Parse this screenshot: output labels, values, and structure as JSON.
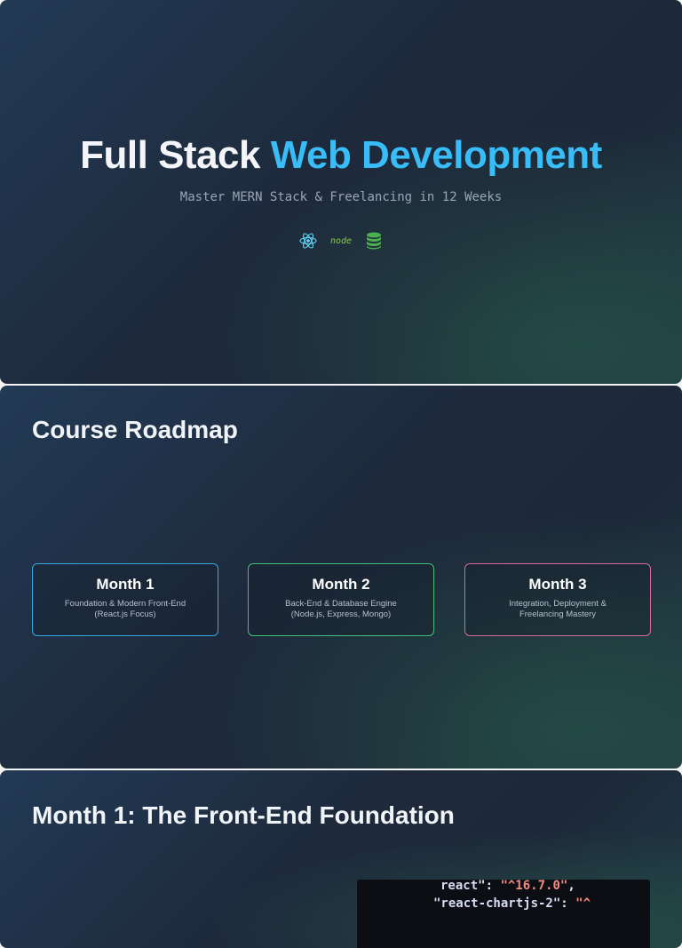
{
  "hero": {
    "title_part1": "Full Stack",
    "title_part2": "Web Development",
    "subtitle": "Master MERN Stack & Freelancing in 12 Weeks",
    "icons": [
      "react-icon",
      "node-icon",
      "database-icon"
    ],
    "node_word": "node"
  },
  "roadmap": {
    "title": "Course Roadmap",
    "cards": [
      {
        "title": "Month 1",
        "line1": "Foundation & Modern Front-End",
        "line2": "(React.js Focus)",
        "border": "#38a8e0"
      },
      {
        "title": "Month 2",
        "line1": "Back-End & Database Engine",
        "line2": "(Node.js, Express, Mongo)",
        "border": "#3fbf7a"
      },
      {
        "title": "Month 3",
        "line1": "Integration, Deployment &",
        "line2": "Freelancing Mastery",
        "border": "#d9679e"
      }
    ]
  },
  "month1": {
    "title": "Month 1: The Front-End Foundation",
    "code": {
      "line1_key": "react",
      "line1_val": "\"^16.7.0\"",
      "line2_key": "\"react-chartjs-2\"",
      "line2_val": "\"^"
    }
  },
  "colors": {
    "accent": "#38bdf8",
    "background": "#1e2a3c"
  }
}
